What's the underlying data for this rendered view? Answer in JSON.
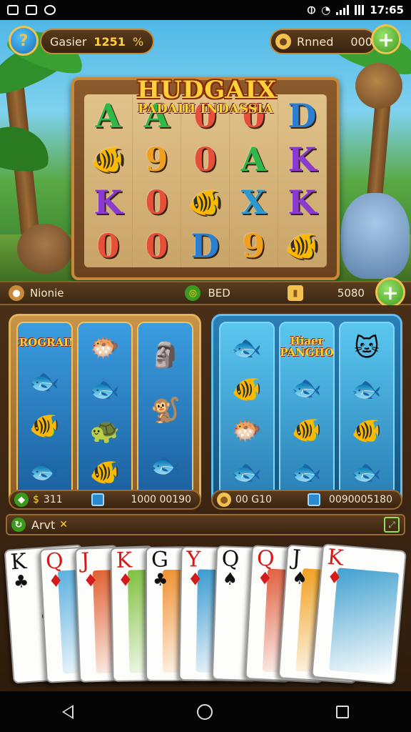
{
  "status_bar": {
    "time": "17:65"
  },
  "top_hud": {
    "left_label": "Gasier",
    "left_value": "1251",
    "left_suffix": "%",
    "right_label": "Rnned",
    "right_value": "000"
  },
  "game_title": {
    "line1": "HUDGAIX",
    "line2": "PADAIH INDASSIA"
  },
  "slot_grid": [
    [
      "A",
      "A",
      "0",
      "0",
      "D"
    ],
    [
      "fish",
      "9",
      "0",
      "A",
      "K"
    ],
    [
      "K",
      "0",
      "fish",
      "X",
      "K"
    ],
    [
      "0",
      "0",
      "D",
      "9",
      "fish"
    ]
  ],
  "info_bar": {
    "left_label": "Nionie",
    "mid_label": "BED",
    "right_value": "5080"
  },
  "left_machine": {
    "label": "CROGRAIN",
    "stat_left": "311",
    "stat_right": "1000 00190"
  },
  "right_machine": {
    "label": "Hiaer PANGHO",
    "stat_left": "00 G10",
    "stat_right": "0090005180"
  },
  "action_bar": {
    "label": "Arvt"
  },
  "cards": [
    {
      "rank": "K",
      "suit": "♣",
      "color": "blk"
    },
    {
      "rank": "Q",
      "suit": "♦",
      "color": "red"
    },
    {
      "rank": "J",
      "suit": "♦",
      "color": "red"
    },
    {
      "rank": "K",
      "suit": "♦",
      "color": "red"
    },
    {
      "rank": "G",
      "suit": "♣",
      "color": "blk"
    },
    {
      "rank": "Y",
      "suit": "♦",
      "color": "red"
    },
    {
      "rank": "Q",
      "suit": "♠",
      "color": "blk"
    },
    {
      "rank": "Q",
      "suit": "♦",
      "color": "red"
    },
    {
      "rank": "J",
      "suit": "♠",
      "color": "blk"
    },
    {
      "rank": "K",
      "suit": "♦",
      "color": "red"
    }
  ],
  "colors": {
    "gold": "#f2c14e",
    "wood": "#8a5a2c",
    "accent_green": "#3b9a1e",
    "accent_blue": "#1b6fb3"
  }
}
